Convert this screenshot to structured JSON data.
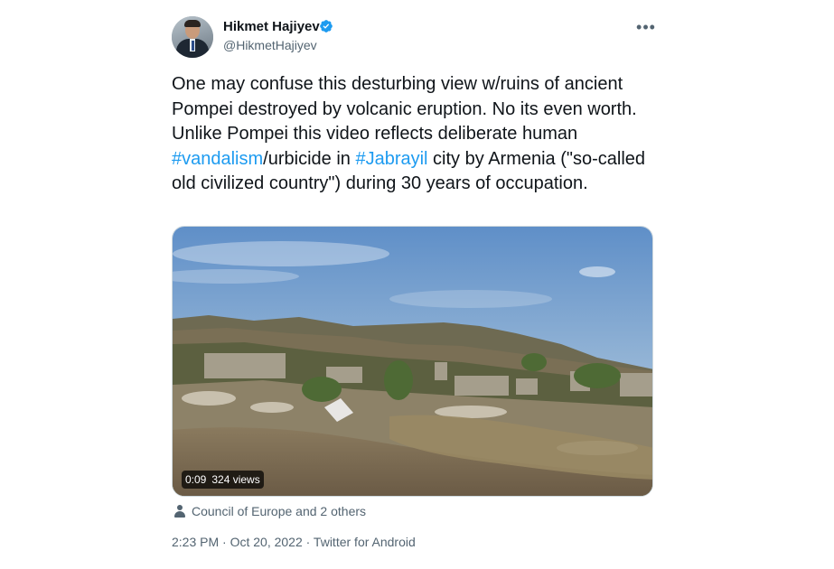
{
  "author": {
    "name": "Hikmet Hajiyev",
    "handle": "@HikmetHajiyev",
    "verified": true
  },
  "tweet": {
    "text_parts": [
      {
        "text": "One may confuse this desturbing view w/ruins of ancient Pompei destroyed by volcanic eruption. No its even worth. Unlike Pompei this video reflects deliberate human ",
        "type": "text"
      },
      {
        "text": "#vandalism",
        "type": "hashtag"
      },
      {
        "text": "/urbicide in ",
        "type": "text"
      },
      {
        "text": "#Jabrayil",
        "type": "hashtag"
      },
      {
        "text": " city by Armenia (\"so-called old civilized country\") during 30 years of occupation.",
        "type": "text"
      }
    ]
  },
  "video": {
    "duration": "0:09",
    "views": "324 views"
  },
  "tagged": "Council of Europe and 2 others",
  "meta": "2:23 PM · Oct 20, 2022 · Twitter for Android",
  "icons": {
    "more": "more-icon",
    "verified": "verified-badge-icon",
    "tagged": "person-icon"
  },
  "colors": {
    "text": "#0f1419",
    "secondary": "#536471",
    "link": "#1d9bf0",
    "verified": "#1d9bf0"
  }
}
